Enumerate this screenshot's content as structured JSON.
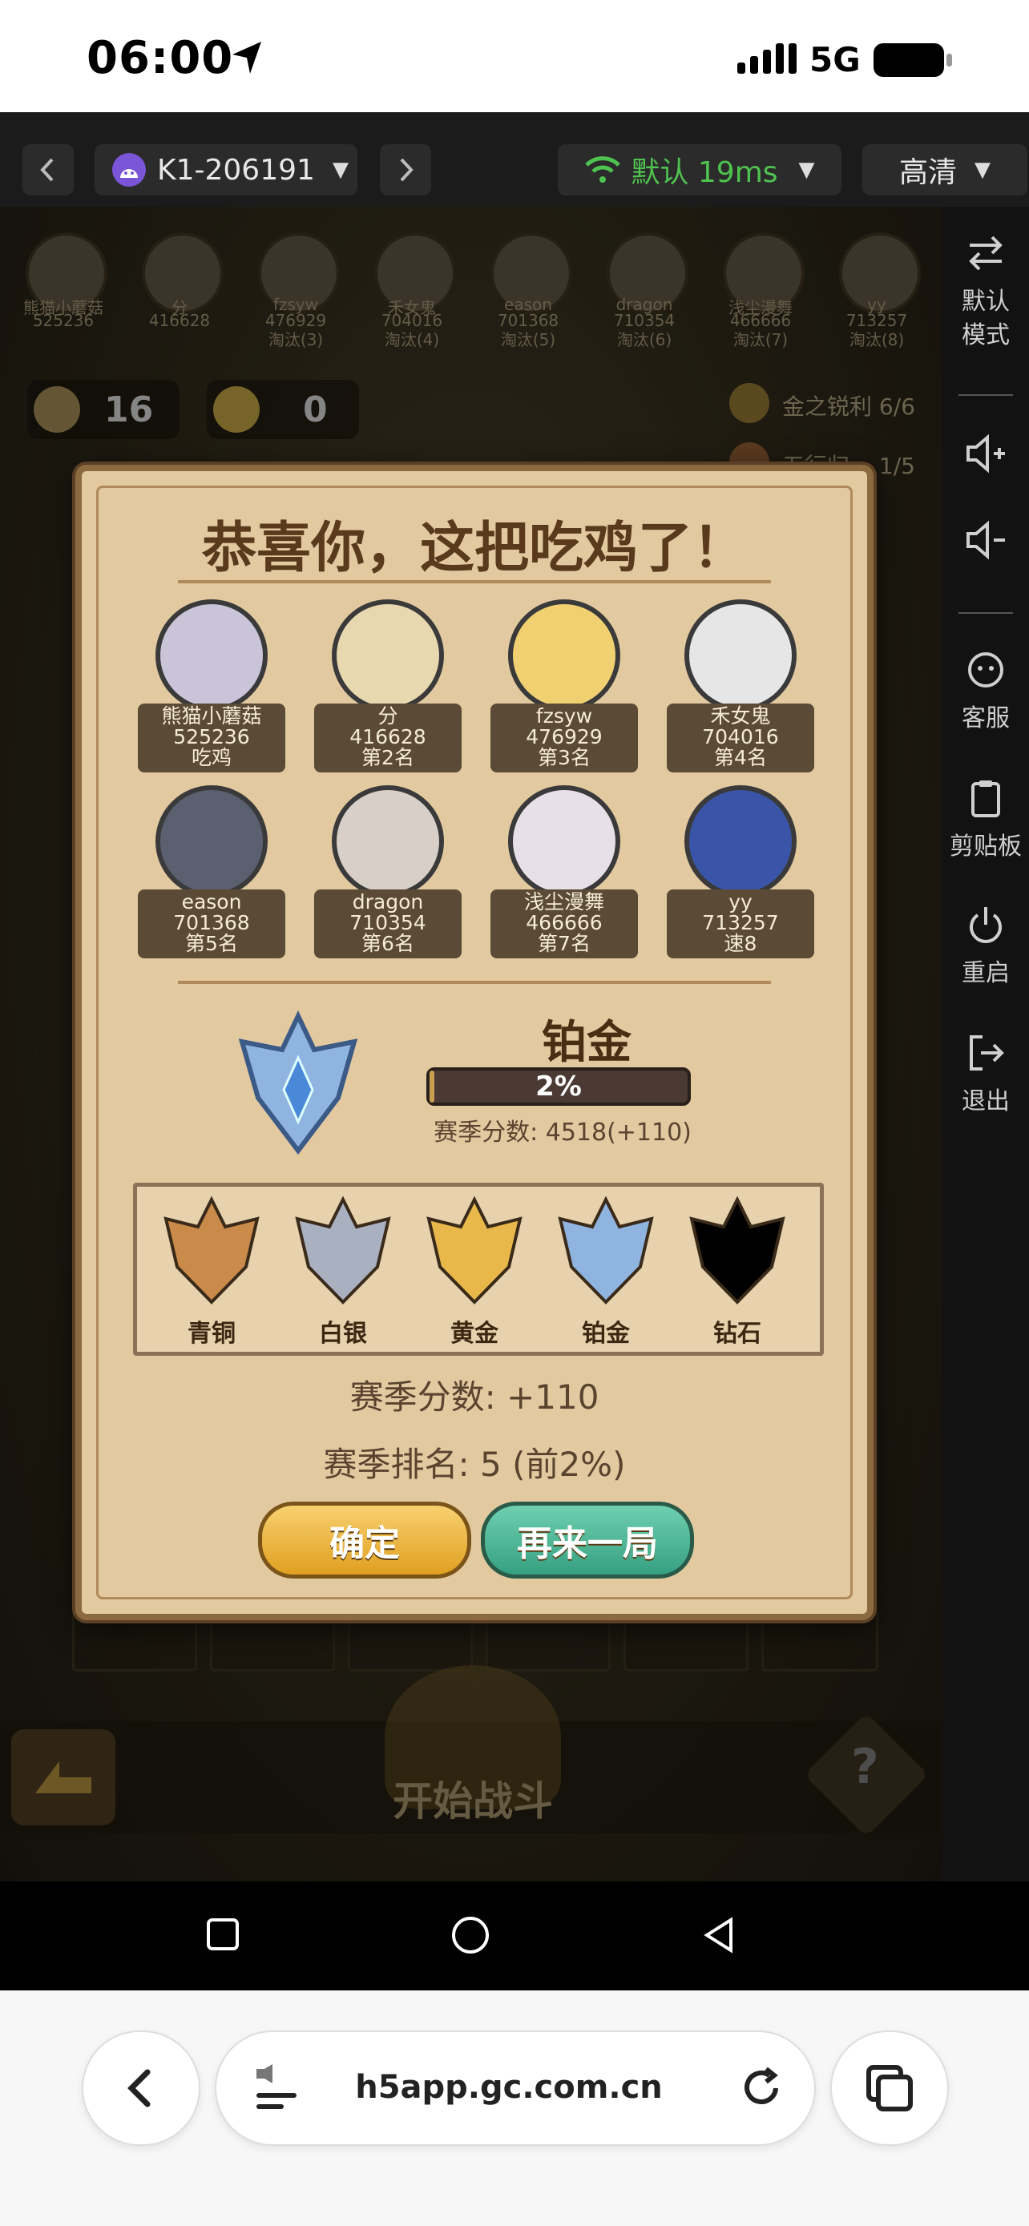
{
  "status_bar": {
    "time": "06:00",
    "network": "5G"
  },
  "toolbar": {
    "device_id": "K1-206191",
    "network_mode": "默认 19ms",
    "quality": "高清"
  },
  "side_panel": {
    "items": [
      {
        "label": "默认\n模式",
        "icon": "swap-icon"
      },
      {
        "label": "",
        "icon": "volume-up-icon"
      },
      {
        "label": "",
        "icon": "volume-down-icon"
      },
      {
        "label": "客服",
        "icon": "support-icon"
      },
      {
        "label": "剪贴板",
        "icon": "clipboard-icon"
      },
      {
        "label": "重启",
        "icon": "power-icon"
      },
      {
        "label": "退出",
        "icon": "exit-icon"
      }
    ]
  },
  "background_hud": {
    "timer_count": "16",
    "coin_count": "0",
    "buff_1": "金之锐利 6/6",
    "buff_2": "五行归一 1/5",
    "start_battle": "开始战斗",
    "top_players": [
      {
        "name": "熊猫小蘑菇",
        "id": "525236"
      },
      {
        "name": "分",
        "id": "416628"
      },
      {
        "name": "fzsyw",
        "id": "476929",
        "status": "淘汰(3)"
      },
      {
        "name": "禾女鬼",
        "id": "704016",
        "status": "淘汰(4)"
      },
      {
        "name": "eason",
        "id": "701368",
        "status": "淘汰(5)"
      },
      {
        "name": "dragon",
        "id": "710354",
        "status": "淘汰(6)"
      },
      {
        "name": "浅尘漫舞",
        "id": "466666",
        "status": "淘汰(7)"
      },
      {
        "name": "yy",
        "id": "713257",
        "status": "淘汰(8)"
      }
    ]
  },
  "dialog": {
    "title": "恭喜你，这把吃鸡了！",
    "players": [
      {
        "name": "熊猫小蘑菇",
        "id": "525236",
        "rank": "吃鸡",
        "color": "#c9c4d8"
      },
      {
        "name": "分",
        "id": "416628",
        "rank": "第2名",
        "color": "#e8d8b0"
      },
      {
        "name": "fzsyw",
        "id": "476929",
        "rank": "第3名",
        "color": "#f0d070"
      },
      {
        "name": "禾女鬼",
        "id": "704016",
        "rank": "第4名",
        "color": "#e6e6e6"
      },
      {
        "name": "eason",
        "id": "701368",
        "rank": "第5名",
        "color": "#5a6070"
      },
      {
        "name": "dragon",
        "id": "710354",
        "rank": "第6名",
        "color": "#d8d0c8"
      },
      {
        "name": "浅尘漫舞",
        "id": "466666",
        "rank": "第7名",
        "color": "#e8e0e8"
      },
      {
        "name": "yy",
        "id": "713257",
        "rank": "速8",
        "color": "#3a55a8"
      }
    ],
    "current_rank": "铂金",
    "progress_label": "2%",
    "progress": 0.02,
    "season_score_line": "赛季分数: 4518(+110)",
    "tiers": [
      {
        "label": "青铜",
        "color": "#c98a4a"
      },
      {
        "label": "白银",
        "color": "#a9b0c0"
      },
      {
        "label": "黄金",
        "color": "#e8b94a"
      },
      {
        "label": "铂金",
        "color": "#8fb4e0"
      },
      {
        "label": "钻石",
        "color": "#000000"
      }
    ],
    "season_score": "赛季分数: +110",
    "season_rank": "赛季排名: 5 (前2%)",
    "confirm_button": "确定",
    "again_button": "再来一局"
  },
  "browser": {
    "url": "h5app.gc.com.cn"
  }
}
